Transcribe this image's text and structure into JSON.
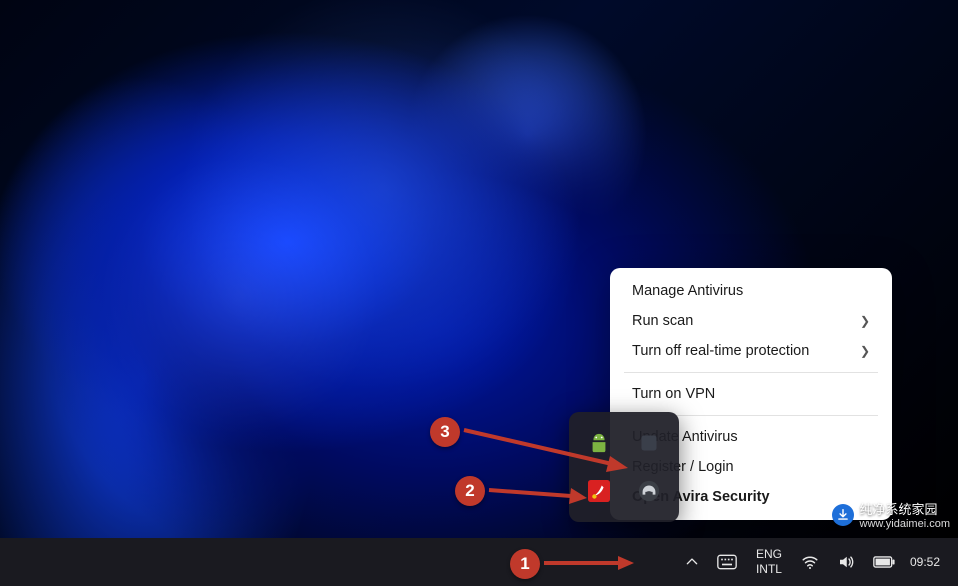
{
  "annotations": {
    "badge1": "1",
    "badge2": "2",
    "badge3": "3"
  },
  "context_menu": {
    "items": [
      {
        "label": "Manage Antivirus",
        "submenu": false,
        "bold": false
      },
      {
        "label": "Run scan",
        "submenu": true,
        "bold": false
      },
      {
        "label": "Turn off real-time protection",
        "submenu": true,
        "bold": false
      }
    ],
    "items2": [
      {
        "label": "Turn on VPN",
        "submenu": false,
        "bold": false
      }
    ],
    "items3": [
      {
        "label": "Update Antivirus",
        "submenu": false,
        "bold": false
      },
      {
        "label": "Register / Login",
        "submenu": false,
        "bold": false
      },
      {
        "label": "Open Avira Security",
        "submenu": false,
        "bold": true
      }
    ]
  },
  "tray_flyout": {
    "icons": [
      "android-icon",
      "generic-icon",
      "avira-icon",
      "headset-icon"
    ]
  },
  "taskbar": {
    "lang_top": "ENG",
    "lang_bottom": "INTL",
    "clock_time": "09:52"
  },
  "watermark": {
    "title": "纯净系统家园",
    "url": "www.yidaimei.com"
  }
}
